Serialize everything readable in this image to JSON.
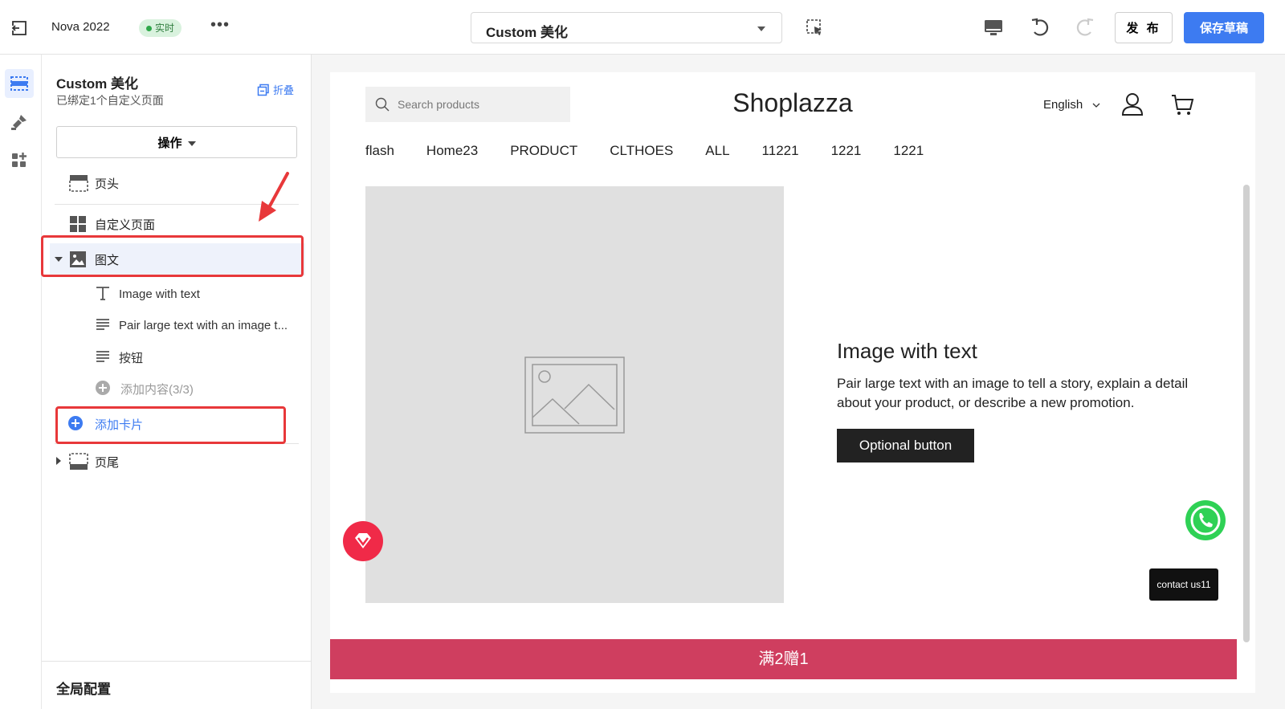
{
  "topbar": {
    "store_name": "Nova 2022",
    "live_badge": "实时",
    "more": "•••",
    "page_select_value": "Custom 美化",
    "publish_label": "发 布",
    "save_label": "保存草稿"
  },
  "panel": {
    "title": "Custom 美化",
    "subtitle": "已绑定1个自定义页面",
    "collapse_label": "折叠",
    "operate_label": "操作",
    "tree": {
      "header": "页头",
      "custom_page": "自定义页面",
      "image_text": "图文",
      "children": [
        {
          "label": "Image with text",
          "icon": "text-T-icon"
        },
        {
          "label": "Pair large text with an image t...",
          "icon": "paragraph-icon"
        },
        {
          "label": "按钮",
          "icon": "paragraph-icon"
        },
        {
          "label": "添加内容(3/3)",
          "icon": "plus-circle-icon"
        }
      ],
      "add_card": "添加卡片",
      "footer": "页尾"
    },
    "global_config": "全局配置"
  },
  "preview": {
    "search_placeholder": "Search products",
    "brand": "Shoplazza",
    "language": "English",
    "nav": [
      "flash",
      "Home23",
      "PRODUCT",
      "CLTHOES",
      "ALL",
      "11221",
      "1221",
      "1221"
    ],
    "iwt_title": "Image with text",
    "iwt_text": "Pair large text with an image to tell a story, explain a detail about your product, or describe a new promotion.",
    "iwt_button": "Optional button",
    "contact": "contact us11",
    "promo": "满2赠1"
  },
  "colors": {
    "accent": "#3d7bf1",
    "live_green": "#2fa84a",
    "highlight_red": "#e8383a",
    "promo_bar": "#cf3e5f",
    "whatsapp": "#2fd155"
  }
}
